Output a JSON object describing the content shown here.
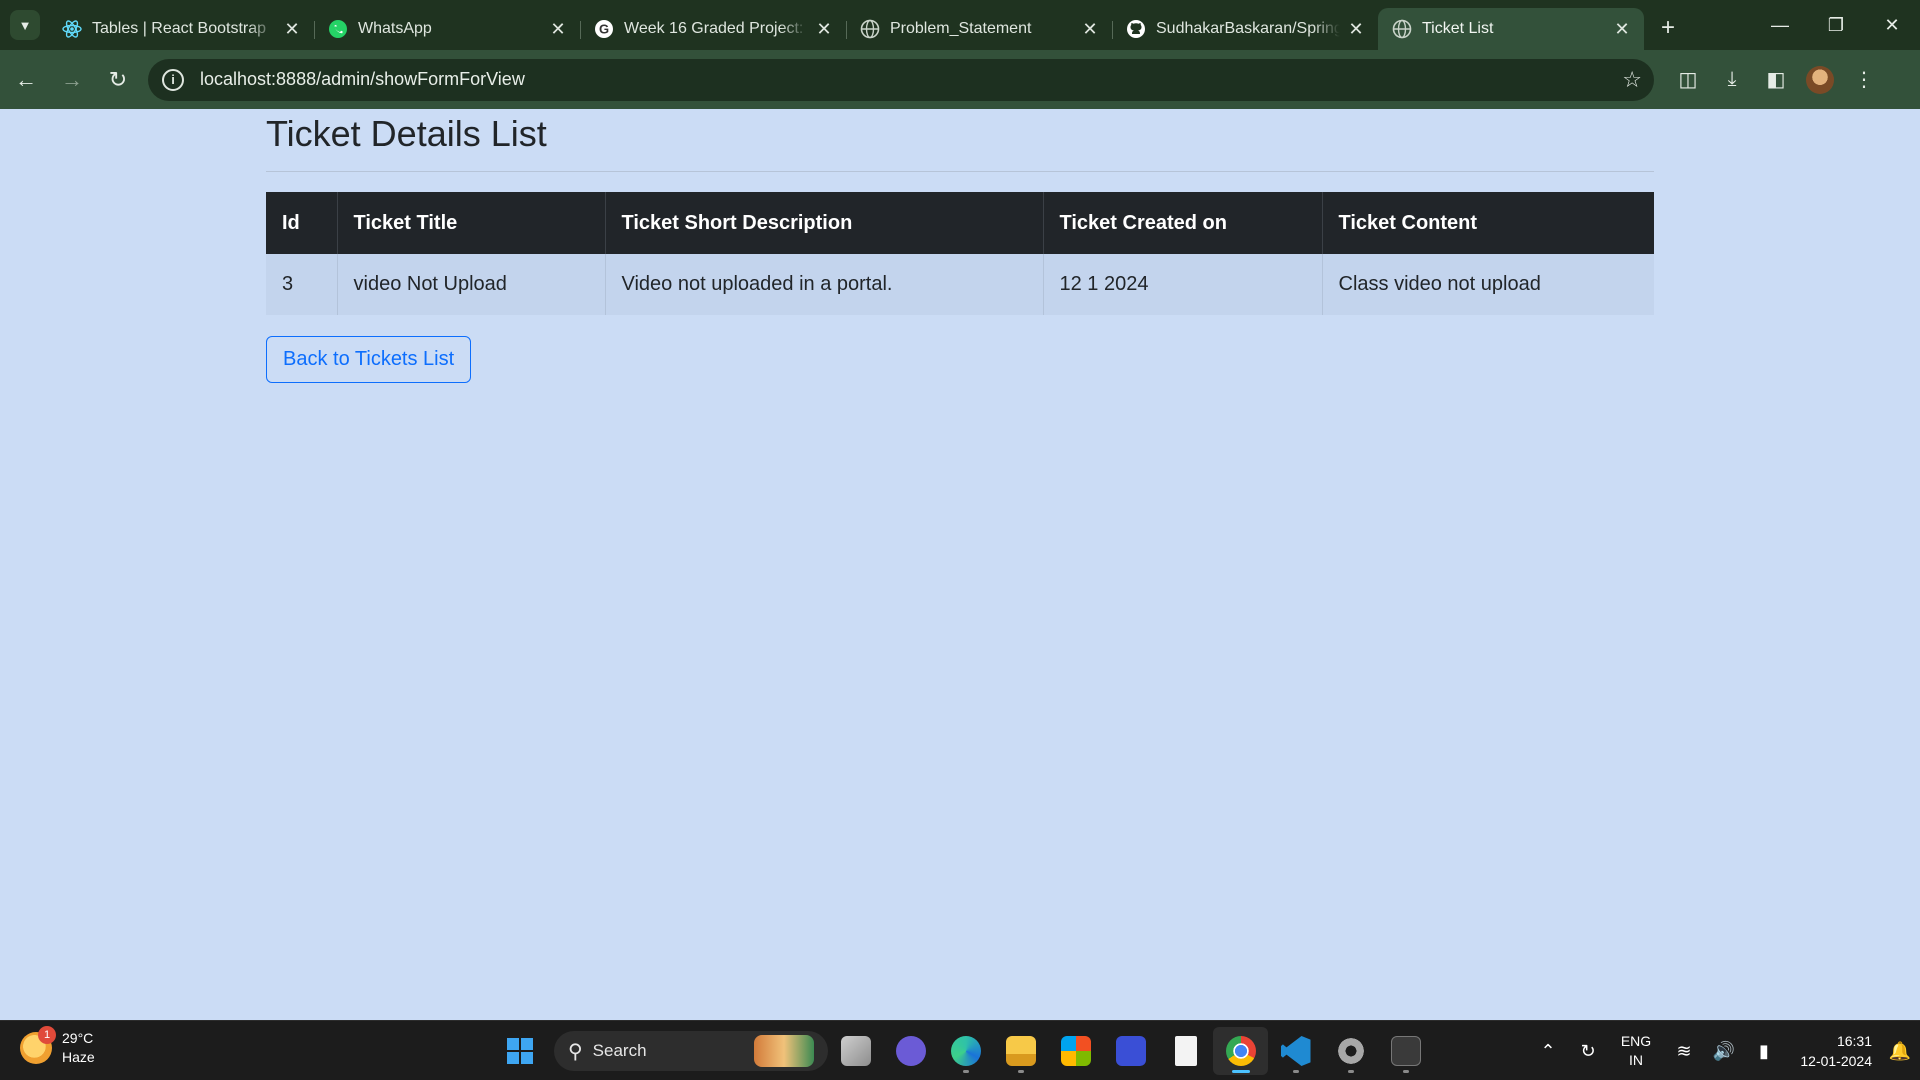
{
  "browser": {
    "tabs": [
      {
        "title": "Tables | React Bootstrap",
        "icon": "react-bootstrap-icon",
        "active": false
      },
      {
        "title": "WhatsApp",
        "icon": "whatsapp-icon",
        "active": false
      },
      {
        "title": "Week 16 Graded Project: Sp",
        "icon": "google-icon",
        "active": false
      },
      {
        "title": "Problem_Statement",
        "icon": "globe-icon",
        "active": false
      },
      {
        "title": "SudhakarBaskaran/SpringW",
        "icon": "github-icon",
        "active": false
      },
      {
        "title": "Ticket List",
        "icon": "globe-icon",
        "active": true
      }
    ],
    "url": "localhost:8888/admin/showFormForView"
  },
  "page": {
    "title": "Ticket Details List",
    "table": {
      "headers": [
        "Id",
        "Ticket Title",
        "Ticket Short Description",
        "Ticket Created on",
        "Ticket Content"
      ],
      "rows": [
        [
          "3",
          "video Not Upload",
          "Video not uploaded in a portal.",
          "12 1 2024",
          "Class video not upload"
        ]
      ]
    },
    "back_button_label": "Back to Tickets List"
  },
  "taskbar": {
    "weather": {
      "temp": "29°C",
      "condition": "Haze",
      "badge": "1"
    },
    "search_label": "Search",
    "language": {
      "line1": "ENG",
      "line2": "IN"
    },
    "time": "16:31",
    "date": "12-01-2024"
  },
  "colors": {
    "page_bg": "#cbdcf5",
    "table_header_bg": "#212529",
    "row_bg": "#c3d4ed",
    "primary": "#0d6efd",
    "chrome_dark": "#1f3320",
    "chrome_toolbar": "#33513a"
  }
}
